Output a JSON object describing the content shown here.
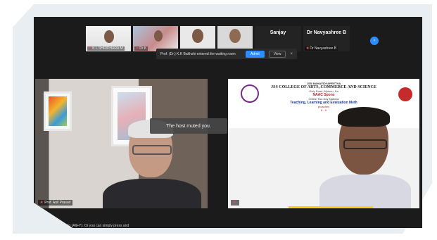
{
  "thumbnails": [
    {
      "label": "K L SHRIDHARA M"
    },
    {
      "label": "Dr K"
    },
    {
      "label": ""
    },
    {
      "label": ""
    },
    {
      "name": "Sanjay",
      "label": ""
    },
    {
      "name": "Dr Navyashree B",
      "label": "Dr Navyashree B"
    }
  ],
  "notification": {
    "message": "Prof. (Dr.) K.K Bakhshi entered the waiting room",
    "admit": "Admit",
    "view": "View",
    "close": "×"
  },
  "more_button": "›",
  "left_video": {
    "participant": "Prof. Anil Prasad",
    "toast": "The host muted you."
  },
  "right_video": {
    "participant": "",
    "slide": {
      "line1": "JSS MAHAVIDYAPEETHA",
      "line2": "JSS COLLEGE OF ARTS, COMMERCE AND SCIENCE",
      "line3": "Ooty Road, Mysuru, Ka",
      "line4": "NAAC Spons",
      "line5": "Online Two Day Nationa",
      "line6": "Teaching, Learning and Evaluation Meth",
      "line7": "proaches",
      "line8": "8 - 9"
    }
  },
  "hint": "Hold My Audio (Alt+Y). Or you can simply press and"
}
